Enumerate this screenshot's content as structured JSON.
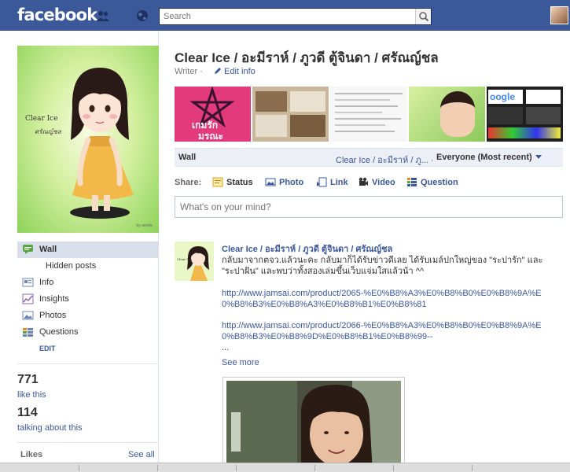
{
  "topbar": {
    "logo": "facebook",
    "search_placeholder": "Search"
  },
  "sidebar": {
    "profile_text": "Clear Ice",
    "profile_subtext": "ศรัณญ์ชล",
    "profile_signature": "by aernie",
    "nav": [
      {
        "label": "Wall",
        "active": true
      },
      {
        "label": "Hidden posts",
        "sub": true
      },
      {
        "label": "Info"
      },
      {
        "label": "Insights"
      },
      {
        "label": "Photos"
      },
      {
        "label": "Questions"
      }
    ],
    "edit_label": "EDIT",
    "likes_count": "771",
    "likes_label": "like this",
    "talking_count": "114",
    "talking_label": "talking about this",
    "likes_heading": "Likes",
    "see_all": "See all"
  },
  "page": {
    "name": "Clear Ice / อะมีราห์ / ภูวดี ตู้จินดา / ศรัณญ์ชล",
    "category": "Writer",
    "separator": "·",
    "edit_info": "Edit info",
    "photo_strip_text1": "เกมรัก",
    "photo_strip_text2": "มรณะ"
  },
  "wall": {
    "title": "Wall",
    "filter_label": "Clear Ice / อะมีราห์ / ภู... ·",
    "sort_label": "Everyone (Most recent)"
  },
  "share": {
    "label": "Share:",
    "items": [
      "Status",
      "Photo",
      "Link",
      "Video",
      "Question"
    ]
  },
  "composer": {
    "placeholder": "What's on your mind?"
  },
  "post": {
    "author": "Clear Ice / อะมีราห์ / ภูวดี ตู้จินดา / ศรัณญ์ชล",
    "body_line1": "กลับมาจากตจว.แล้วนะคะ กลับมาก็ได้รับข่าวดีเลย ได้รับเมล์ปกใหญ่ของ \"ระปารัก\" และ",
    "body_line2": "\"ระปาฝัน\" และพบว่าทั้งสองเล่มขึ้นเว็บแจ่มใสแล้วน้า ^^",
    "link1": "http://www.jamsai.com/product/2065-%E0%B8%A3%E0%B8%B0%E0%B8%9A%E0%B8%B3%E0%B8%A3%E0%B8%B1%E0%B8%81",
    "link2": "http://www.jamsai.com/product/2066-%E0%B8%A3%E0%B8%B0%E0%B8%9A%E0%B8%B3%E0%B8%9D%E0%B8%B1%E0%B8%99--",
    "ellipsis": "...",
    "see_more": "See more"
  },
  "colors": {
    "brand": "#3b5998",
    "nav_active": "#d8dfea"
  }
}
